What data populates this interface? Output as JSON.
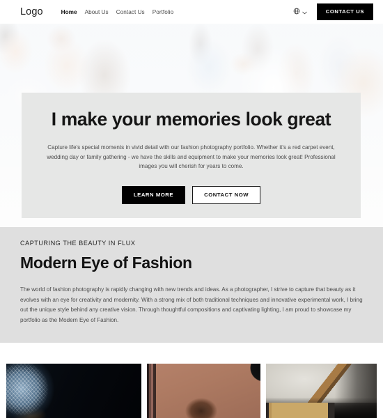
{
  "nav": {
    "logo": "Logo",
    "links": [
      {
        "label": "Home",
        "active": true
      },
      {
        "label": "About Us",
        "active": false
      },
      {
        "label": "Contact Us",
        "active": false
      },
      {
        "label": "Portfolio",
        "active": false
      }
    ],
    "language_icon": "globe-icon",
    "language_chevron": "chevron-down-icon",
    "cta_label": "CONTACT US"
  },
  "hero": {
    "title": "I make your memories look great",
    "description": "Capture life's special moments in vivid detail with our fashion photography portfolio. Whether it's a red carpet event, wedding day or family gathering - we have the skills and equipment to make your memories look great! Professional images you will cherish for years to come.",
    "primary_button": "LEARN MORE",
    "secondary_button": "CONTACT NOW",
    "background_alt": "faded photo of four fashion models"
  },
  "about": {
    "eyebrow": "CAPTURING THE BEAUTY IN FLUX",
    "title": "Modern Eye of Fashion",
    "body": "The world of fashion photography is rapidly changing with new trends and ideas. As a photographer, I strive to capture that beauty as it evolves with an eye for creativity and modernity. With a strong mix of both traditional techniques and innovative experimental work, I bring out the unique style behind any creative vision. Through thoughtful compositions and captivating lighting, I am proud to showcase my portfolio as the Modern Eye of Fashion."
  },
  "gallery": {
    "items": [
      {
        "alt": "dark studio shot with blue sequined sphere"
      },
      {
        "alt": "curly haired model on tan backdrop"
      },
      {
        "alt": "studio interior with wooden ceiling beam"
      }
    ]
  },
  "colors": {
    "page_background": "#ffffff",
    "hero_card_background": "#e6e7e6",
    "about_background": "#dfdfdf",
    "button_primary": "#000000",
    "button_primary_text": "#ffffff",
    "text_primary": "#141414",
    "text_muted": "#4d4d4d"
  }
}
